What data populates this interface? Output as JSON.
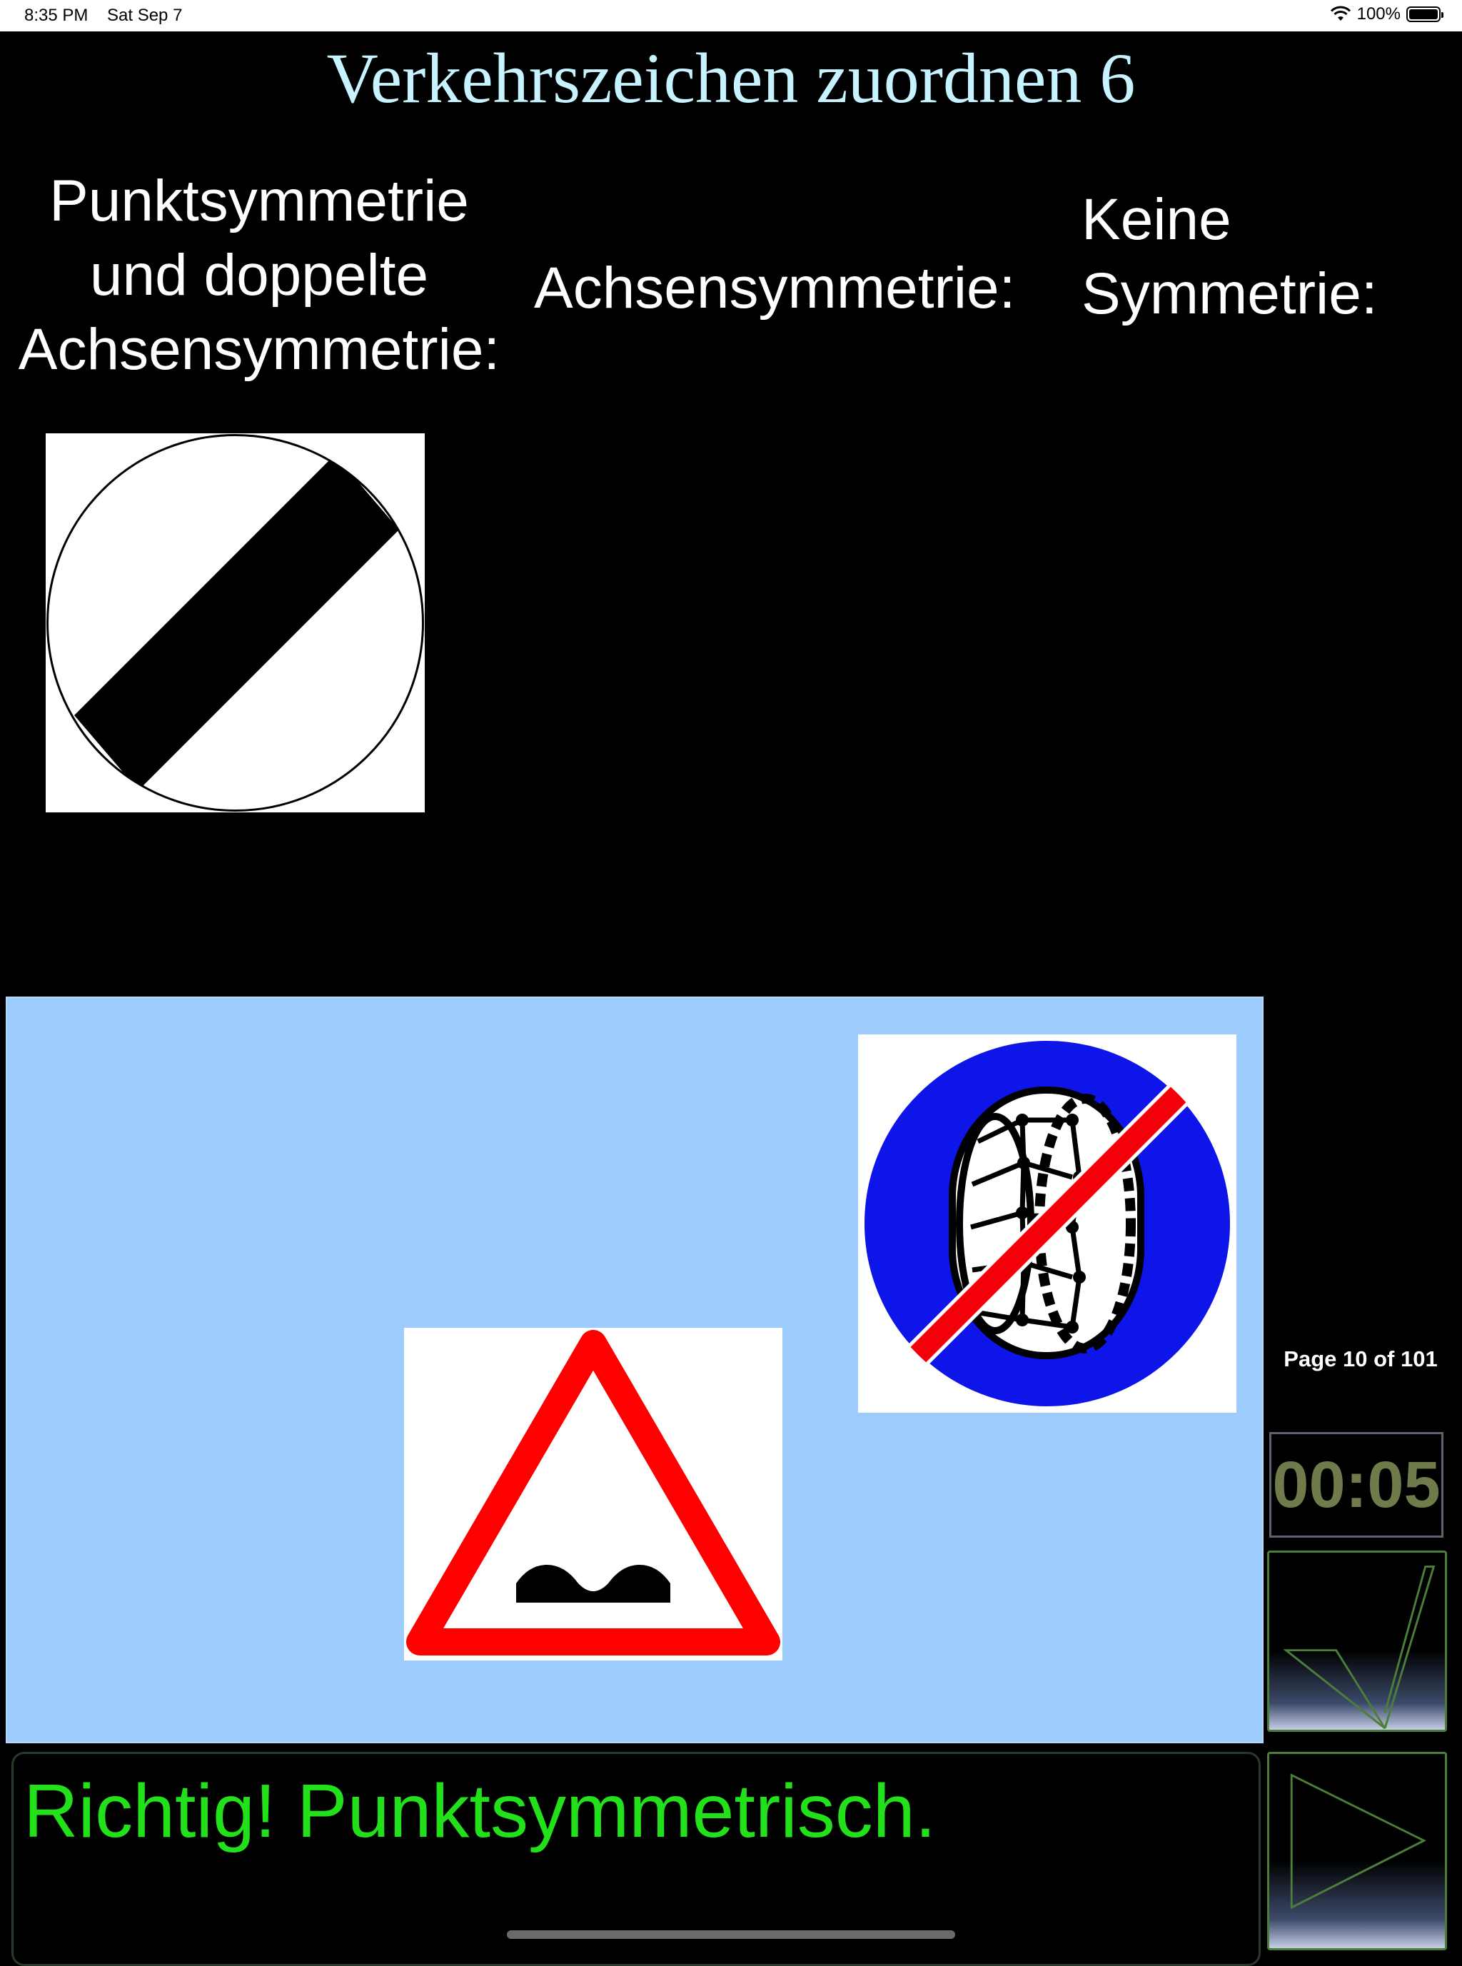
{
  "status_bar": {
    "time": "8:35 PM",
    "date": "Sat Sep 7",
    "battery": "100%"
  },
  "title": "Verkehrszeichen zuordnen 6",
  "categories": {
    "c1": {
      "line1": "Punktsymmetrie",
      "line2": "und doppelte",
      "line3": "Achsensymmetrie:"
    },
    "c2": {
      "line1": "Achsensymmetrie:"
    },
    "c3": {
      "line1": "Keine",
      "line2": "Symmetrie:"
    }
  },
  "signs": {
    "placed": [
      "end-of-all-restrictions-sign"
    ],
    "tray": [
      "end-of-snow-chains-sign",
      "speed-bump-warning-sign"
    ]
  },
  "page": {
    "label": "Page 10 of 101"
  },
  "timer": {
    "value": "00:05"
  },
  "feedback": {
    "text": "Richtig! Punktsymmetrisch."
  },
  "colors": {
    "title": "#c6f3ff",
    "tray_background": "#9dcbfb",
    "feedback_text": "#22e01a",
    "timer_text": "#6f7b4a",
    "button_border": "#4c7d3a"
  }
}
